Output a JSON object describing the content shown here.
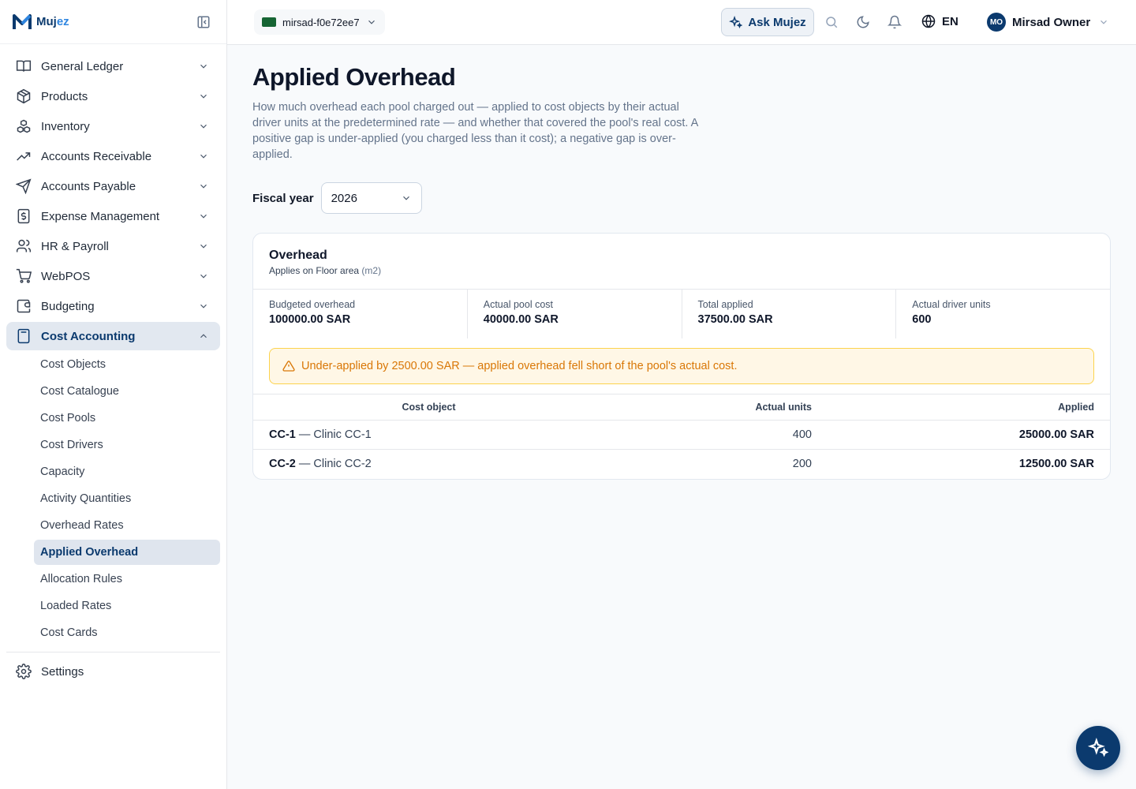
{
  "brand": {
    "name_main": "Muj",
    "name_accent": "ez"
  },
  "sidebar": {
    "items": [
      {
        "label": "General Ledger",
        "icon": "book-open-icon"
      },
      {
        "label": "Products",
        "icon": "package-icon"
      },
      {
        "label": "Inventory",
        "icon": "boxes-icon"
      },
      {
        "label": "Accounts Receivable",
        "icon": "trending-up-icon"
      },
      {
        "label": "Accounts Payable",
        "icon": "send-icon"
      },
      {
        "label": "Expense Management",
        "icon": "receipt-dollar-icon"
      },
      {
        "label": "HR & Payroll",
        "icon": "users-icon"
      },
      {
        "label": "WebPOS",
        "icon": "cart-icon"
      },
      {
        "label": "Budgeting",
        "icon": "wallet-icon"
      },
      {
        "label": "Cost Accounting",
        "icon": "calculator-icon"
      }
    ],
    "cost_sub": [
      "Cost Objects",
      "Cost Catalogue",
      "Cost Pools",
      "Cost Drivers",
      "Capacity",
      "Activity Quantities",
      "Overhead Rates",
      "Applied Overhead",
      "Allocation Rules",
      "Loaded Rates",
      "Cost Cards"
    ],
    "settings": "Settings"
  },
  "header": {
    "org": "mirsad-f0e72ee7",
    "ask": "Ask Mujez",
    "lang": "EN",
    "avatar_initials": "MO",
    "user_name": "Mirsad Owner"
  },
  "page": {
    "title": "Applied Overhead",
    "description": "How much overhead each pool charged out — applied to cost objects by their actual driver units at the predetermined rate — and whether that covered the pool's real cost. A positive gap is under-applied (you charged less than it cost); a negative gap is over-applied.",
    "fy_label": "Fiscal year",
    "fy_value": "2026"
  },
  "pool": {
    "name": "Overhead",
    "applies_prefix": "Applies on Floor area",
    "applies_unit": "(m2)",
    "stats": [
      {
        "label": "Budgeted overhead",
        "value": "100000.00 SAR"
      },
      {
        "label": "Actual pool cost",
        "value": "40000.00 SAR"
      },
      {
        "label": "Total applied",
        "value": "37500.00 SAR"
      },
      {
        "label": "Actual driver units",
        "value": "600"
      }
    ],
    "alert": "Under-applied by 2500.00 SAR — applied overhead fell short of the pool's actual cost.",
    "table": {
      "headers": [
        "Cost object",
        "Actual units",
        "Applied"
      ],
      "rows": [
        {
          "code": "CC-1",
          "name": " — Clinic CC-1",
          "units": "400",
          "applied": "25000.00 SAR"
        },
        {
          "code": "CC-2",
          "name": " — Clinic CC-2",
          "units": "200",
          "applied": "12500.00 SAR"
        }
      ]
    }
  },
  "colors": {
    "brand": "#0b3a6e",
    "accent": "#2f86e0",
    "warning": "#d97706"
  }
}
